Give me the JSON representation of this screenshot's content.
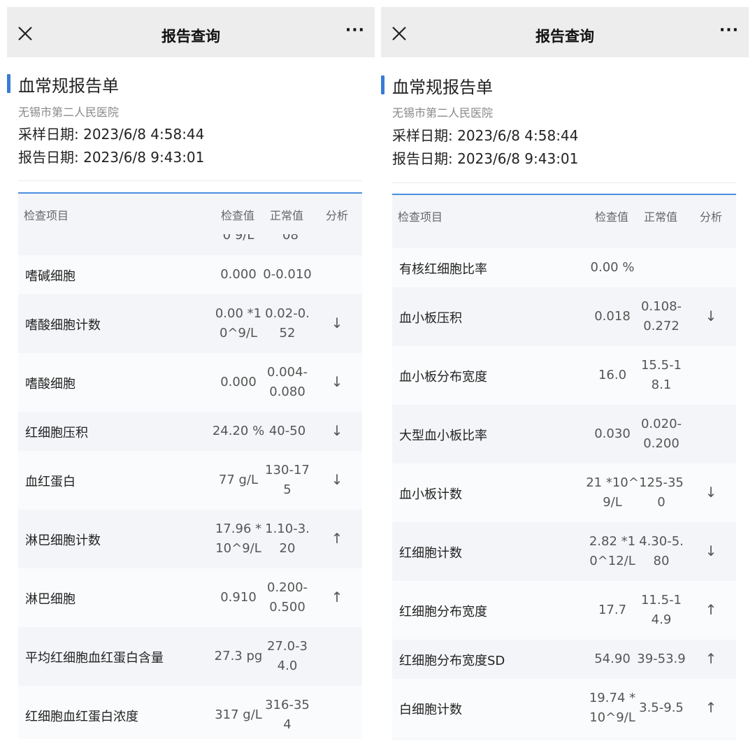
{
  "left": {
    "topbar": {
      "title": "报告查询",
      "more": "···"
    },
    "report": {
      "title": "血常规报告单",
      "hospital": "无锡市第二人民医院",
      "sample_date": "采样日期:  2023/6/8 4:58:44",
      "report_date": "报告日期:  2023/6/8 9:43:01"
    },
    "headers": {
      "item": "检查项目",
      "value": "检查值",
      "normal": "正常值",
      "analysis": "分析"
    },
    "partial_row": {
      "value": "0 9/L",
      "normal": "08"
    },
    "rows": [
      {
        "name": "嗜碱细胞",
        "value": [
          "0.000"
        ],
        "normal": [
          "0-0.010"
        ],
        "analysis": ""
      },
      {
        "name": "嗜酸细胞计数",
        "value": [
          "0.00 *1",
          "0^9/L"
        ],
        "normal": [
          "0.02-0.",
          "52"
        ],
        "analysis": "↓"
      },
      {
        "name": "嗜酸细胞",
        "value": [
          "0.000"
        ],
        "normal": [
          "0.004-",
          "0.080"
        ],
        "analysis": "↓"
      },
      {
        "name": "红细胞压积",
        "value": [
          "24.20 %"
        ],
        "normal": [
          "40-50"
        ],
        "analysis": "↓"
      },
      {
        "name": "血红蛋白",
        "value": [
          "77 g/L"
        ],
        "normal": [
          "130-17",
          "5"
        ],
        "analysis": "↓"
      },
      {
        "name": "淋巴细胞计数",
        "value": [
          "17.96 *",
          "10^9/L"
        ],
        "normal": [
          "1.10-3.",
          "20"
        ],
        "analysis": "↑"
      },
      {
        "name": "淋巴细胞",
        "value": [
          "0.910"
        ],
        "normal": [
          "0.200-",
          "0.500"
        ],
        "analysis": "↑"
      },
      {
        "name": "平均红细胞血红蛋白含量",
        "value": [
          "27.3 pg"
        ],
        "normal": [
          "27.0-3",
          "4.0"
        ],
        "analysis": ""
      },
      {
        "name": "红细胞血红蛋白浓度",
        "value": [
          "317 g/L"
        ],
        "normal": [
          "316-35",
          "4"
        ],
        "analysis": ""
      }
    ]
  },
  "right": {
    "topbar": {
      "title": "报告查询",
      "more": "···"
    },
    "report": {
      "title": "血常规报告单",
      "hospital": "无锡市第二人民医院",
      "sample_date": "采样日期:  2023/6/8 4:58:44",
      "report_date": "报告日期:  2023/6/8 9:43:01"
    },
    "headers": {
      "item": "检查项目",
      "value": "检查值",
      "normal": "正常值",
      "analysis": "分析"
    },
    "rows": [
      {
        "name": "有核红细胞比率",
        "value": [
          "0.00 %"
        ],
        "normal": [
          ""
        ],
        "analysis": ""
      },
      {
        "name": "血小板压积",
        "value": [
          "0.018"
        ],
        "normal": [
          "0.108-",
          "0.272"
        ],
        "analysis": "↓"
      },
      {
        "name": "血小板分布宽度",
        "value": [
          "16.0"
        ],
        "normal": [
          "15.5-1",
          "8.1"
        ],
        "analysis": ""
      },
      {
        "name": "大型血小板比率",
        "value": [
          "0.030"
        ],
        "normal": [
          "0.020-",
          "0.200"
        ],
        "analysis": ""
      },
      {
        "name": "血小板计数",
        "value": [
          "21 *10^",
          "9/L"
        ],
        "normal": [
          "125-35",
          "0"
        ],
        "analysis": "↓"
      },
      {
        "name": "红细胞计数",
        "value": [
          "2.82 *1",
          "0^12/L"
        ],
        "normal": [
          "4.30-5.",
          "80"
        ],
        "analysis": "↓"
      },
      {
        "name": "红细胞分布宽度",
        "value": [
          "17.7"
        ],
        "normal": [
          "11.5-1",
          "4.9"
        ],
        "analysis": "↑"
      },
      {
        "name": "红细胞分布宽度SD",
        "value": [
          "54.90"
        ],
        "normal": [
          "39-53.9"
        ],
        "analysis": "↑"
      },
      {
        "name": "白细胞计数",
        "value": [
          "19.74 *",
          "10^9/L"
        ],
        "normal": [
          "3.5-9.5"
        ],
        "analysis": "↑"
      }
    ]
  }
}
